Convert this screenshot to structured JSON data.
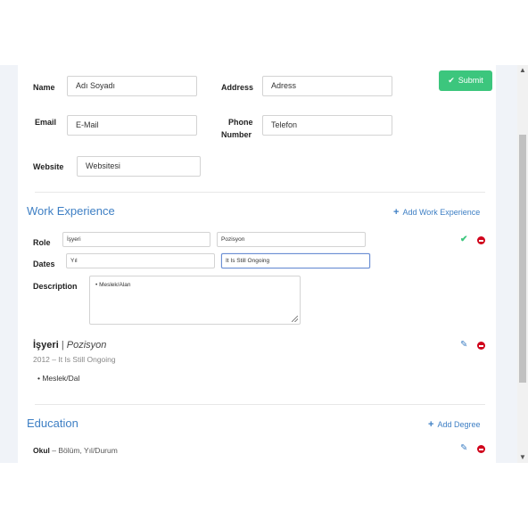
{
  "form": {
    "submit_label": "Submit",
    "name_label": "Name",
    "name_value": "Adı Soyadı",
    "address_label": "Address",
    "address_value": "Adress",
    "email_label": "Email",
    "email_value": "E-Mail",
    "phone_label_1": "Phone",
    "phone_label_2": "Number",
    "phone_value": "Telefon",
    "website_label": "Website",
    "website_value": "Websitesi"
  },
  "work": {
    "title": "Work Experience",
    "add_label": "Add Work Experience",
    "role_label": "Role",
    "company_value": "İşyeri",
    "position_value": "Pozisyon",
    "dates_label": "Dates",
    "year_value": "Yıl",
    "ongoing_value": "It Is Still Ongoing",
    "description_label": "Description",
    "description_bullet": "• Meslek/Alan",
    "entry": {
      "company": "İşyeri",
      "separator": "|",
      "position": "Pozisyon",
      "dates": "2012 – It Is Still Ongoing",
      "bullet": "• Meslek/Dal"
    }
  },
  "education": {
    "title": "Education",
    "add_label": "Add Degree",
    "entry_school": "Okul",
    "entry_rest": " – Bölüm, Yıl/Durum"
  },
  "icons": {
    "confirm": "check-icon",
    "delete": "minus-circle-icon",
    "edit": "pencil-icon",
    "add": "plus-icon"
  },
  "colors": {
    "accent": "#3e7fc4",
    "success": "#3cc67d",
    "danger": "#d0021b",
    "gutter": "#f0f3f8"
  }
}
